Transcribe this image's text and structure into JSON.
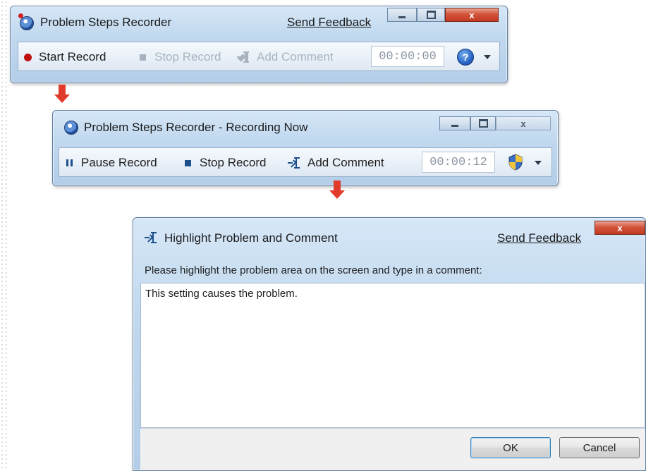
{
  "window1": {
    "title": "Problem Steps Recorder",
    "feedback": "Send Feedback",
    "close_glyph": "x",
    "toolbar": {
      "start": "Start Record",
      "stop": "Stop Record",
      "comment": "Add Comment",
      "timer": "00:00:00"
    },
    "help_glyph": "?"
  },
  "window2": {
    "title": "Problem Steps Recorder - Recording Now",
    "close_glyph": "x",
    "toolbar": {
      "pause": "Pause Record",
      "stop": "Stop Record",
      "comment": "Add Comment",
      "timer": "00:00:12"
    }
  },
  "dialog": {
    "title": "Highlight Problem and Comment",
    "feedback": "Send Feedback",
    "close_glyph": "x",
    "prompt": "Please highlight the problem area on the screen and type in a comment:",
    "comment_text": "This setting causes the problem.",
    "ok": "OK",
    "cancel": "Cancel"
  },
  "icons": {
    "app": "problem-steps-recorder-icon",
    "help": "help-icon",
    "shield": "uac-shield-icon",
    "arrow": "red-down-arrow"
  },
  "colors": {
    "frame": "#c1d8ef",
    "record_dot": "#c00f0f",
    "arrow": "#e13b2b",
    "close_button": "#d2543a"
  }
}
